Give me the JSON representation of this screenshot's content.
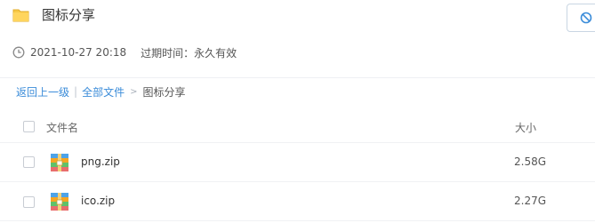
{
  "share": {
    "title": "图标分享",
    "time": "2021-10-27 20:18",
    "expiry_label": "过期时间：",
    "expiry_value": "永久有效"
  },
  "breadcrumb": {
    "back": "返回上一级",
    "all_files": "全部文件",
    "current": "图标分享"
  },
  "list": {
    "columns": {
      "name": "文件名",
      "size": "大小"
    },
    "files": [
      {
        "name": "png.zip",
        "size": "2.58G"
      },
      {
        "name": "ico.zip",
        "size": "2.27G"
      }
    ]
  },
  "colors": {
    "link": "#3b8cd9",
    "folder": "#f7c948"
  },
  "icons": [
    "folder-icon",
    "cancel-share-icon",
    "clock-icon",
    "zip-file-icon"
  ]
}
